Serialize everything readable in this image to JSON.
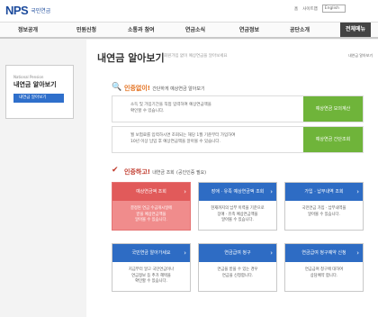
{
  "header": {
    "logo": "NPS",
    "logo_sub": "국민연금",
    "links": [
      "홈",
      "사이트맵"
    ],
    "lang": "English"
  },
  "nav": {
    "items": [
      "정보공개",
      "민원신청",
      "소통과 참여",
      "연금소식",
      "연금정보",
      "공단소개",
      "전체메뉴"
    ]
  },
  "sidebar": {
    "en": "National Pension",
    "title": "내연금 알아보기",
    "item": "내연금 알아보기"
  },
  "page": {
    "title": "내연금 알아보기",
    "desc": "회원가입 없이 예상연금을 알아보세요",
    "breadcrumb": "내연금 알아보기"
  },
  "sec1": {
    "lead": "인증없이!",
    "title": "간단하게 예상연금 알아보기"
  },
  "rows": [
    {
      "text1": "소득 및 가입기간을 직접 입력하여 예상연금액을",
      "text2": "확인할 수 있습니다.",
      "btn": "예상연금 모의계산"
    },
    {
      "text1": "월 보험료를 입력하시면 조회되는 해당 1월 기준부터 가입하여",
      "text2": "10년 이상 납입 후 예상연금액을 알아볼 수 있습니다.",
      "btn": "예상연금 간단조회"
    }
  ],
  "sec2": {
    "lead": "인증하고!",
    "title": "내연금 조회",
    "note": "(공인인증 필요)"
  },
  "cards": [
    {
      "title": "예상연금액 조회",
      "l1": "결정된 연금 수급개시일에",
      "l2": "받을 예상연금액을",
      "l3": "알아볼 수 있습니다."
    },
    {
      "title": "장애 · 유족 예상연금액 조회",
      "l1": "현재까지의 납부 이력을 기준으로",
      "l2": "장애 · 유족 예상연금액을",
      "l3": "알아볼 수 있습니다."
    },
    {
      "title": "가입 · 납부내역 조회",
      "l1": "국민연금 가입 · 납부내역을",
      "l2": "알아볼 수 있습니다.",
      "l3": ""
    },
    {
      "title": "국민연금 알아가세요",
      "l1": "지금부터 알고 국민연금이나",
      "l2": "연금정보 등 추가 혜택을",
      "l3": "확인할 수 있습니다."
    },
    {
      "title": "연금급여 청구",
      "l1": "연금을 받을 수 있는 경우",
      "l2": "연금을 신청합니다.",
      "l3": ""
    },
    {
      "title": "연금급여 청구예약 신청",
      "l1": "연금급여 청구에 대하여",
      "l2": "상담예약 합니다.",
      "l3": ""
    }
  ]
}
